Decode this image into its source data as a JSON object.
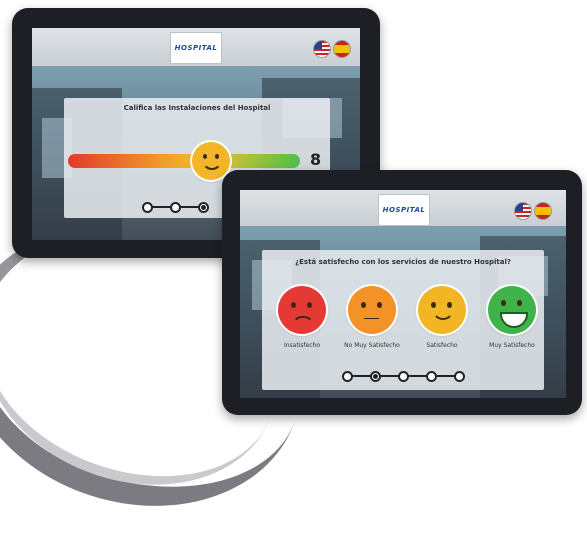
{
  "tablet_back": {
    "logo_text": "HOSPITAL",
    "title": "Califica las Instalaciones del Hospital",
    "score": "8",
    "flags": [
      "us-flag-icon",
      "es-flag-icon"
    ],
    "progress_steps": 3,
    "active_step": 3
  },
  "tablet_front": {
    "logo_text": "HOSPITAL",
    "title": "¿Está satisfecho con los servicios de nuestro Hospital?",
    "options": [
      {
        "label": "Insatisfecho",
        "color": "#e53935",
        "mood": "sad"
      },
      {
        "label": "No Muy Satisfecho",
        "color": "#f29227",
        "mood": "meh"
      },
      {
        "label": "Satisfecho",
        "color": "#f2b624",
        "mood": "smile"
      },
      {
        "label": "Muy Satisfecho",
        "color": "#3fb34a",
        "mood": "laugh"
      }
    ],
    "progress_steps": 5,
    "active_step": 2
  },
  "colors": {
    "bezel": "#1e1f24",
    "accent_blue": "#1d4b9a"
  }
}
